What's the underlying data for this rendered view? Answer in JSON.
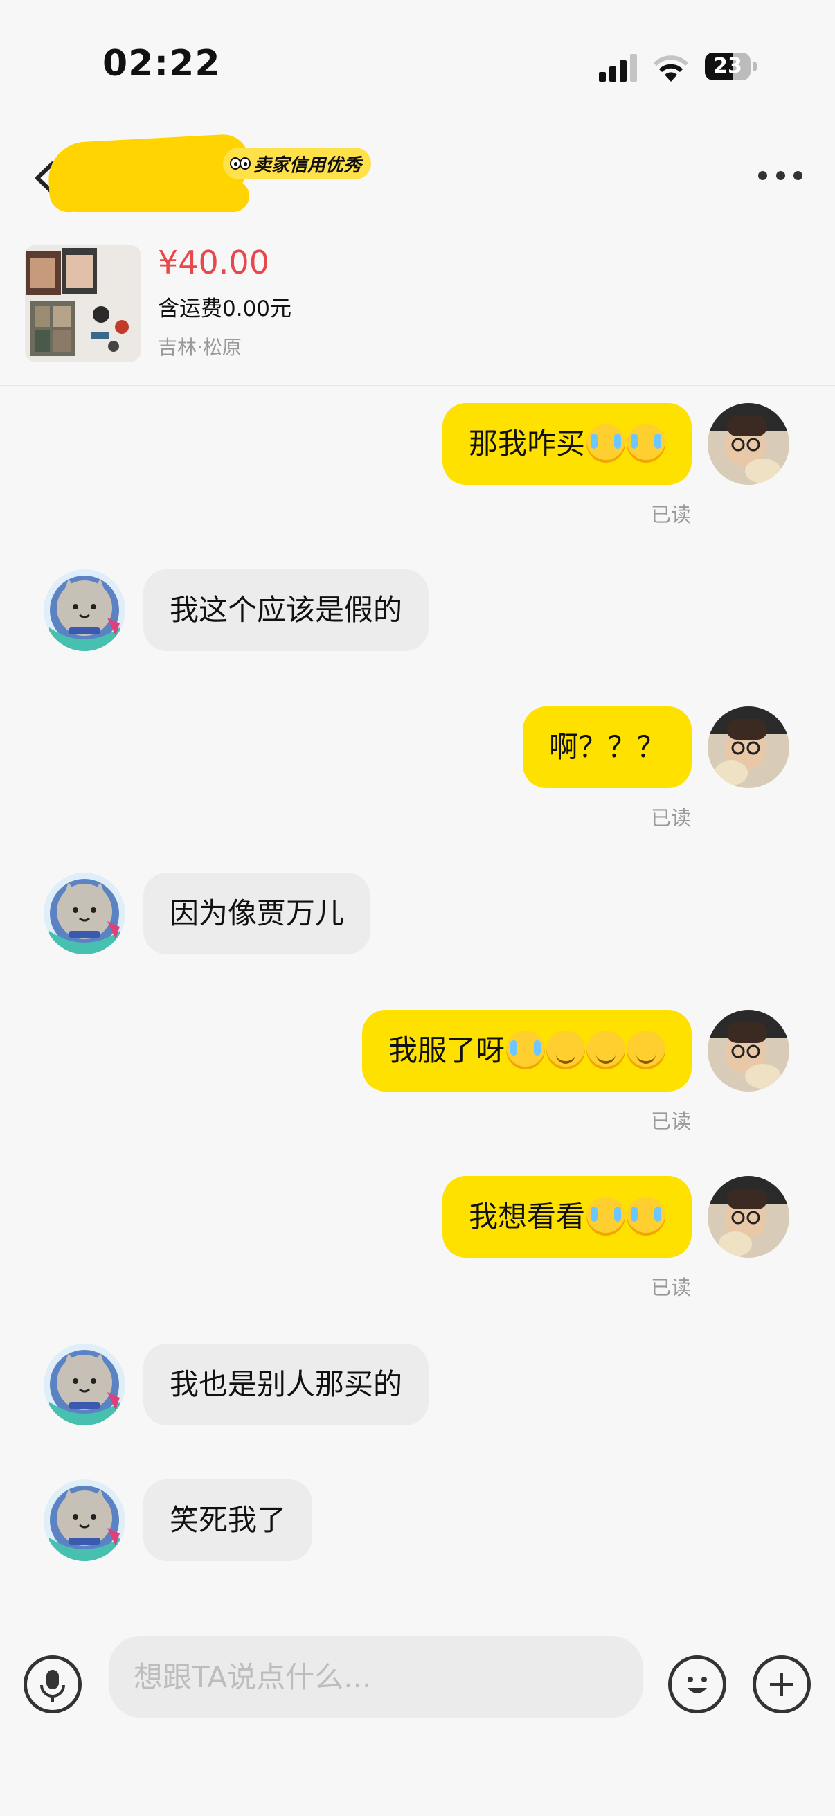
{
  "status_bar": {
    "time": "02:22",
    "battery_level": "23",
    "battery_fraction": 0.23
  },
  "header": {
    "credit_badge": "卖家信用优秀",
    "seller_name_redacted": true
  },
  "product": {
    "price": "¥40.00",
    "shipping": "含运费0.00元",
    "location": "吉林·松原"
  },
  "messages": [
    {
      "side": "me",
      "text": "那我咋买",
      "emoji": [
        "cry",
        "cry"
      ],
      "status": "已读"
    },
    {
      "side": "them",
      "text": "我这个应该是假的"
    },
    {
      "side": "me",
      "text": "啊？？？",
      "emoji": [],
      "status": "已读"
    },
    {
      "side": "them",
      "text": "因为像贾万儿"
    },
    {
      "side": "me",
      "text": "我服了呀",
      "emoji": [
        "cry",
        "smile",
        "smile",
        "smile"
      ],
      "status": "已读"
    },
    {
      "side": "me",
      "text": "我想看看",
      "emoji": [
        "cry",
        "cry"
      ],
      "status": "已读"
    },
    {
      "side": "them",
      "text": "我也是别人那买的"
    },
    {
      "side": "them",
      "text": "笑死我了"
    }
  ],
  "input": {
    "placeholder": "想跟TA说点什么..."
  },
  "colors": {
    "accent": "#ffe100",
    "price": "#e8474b"
  }
}
